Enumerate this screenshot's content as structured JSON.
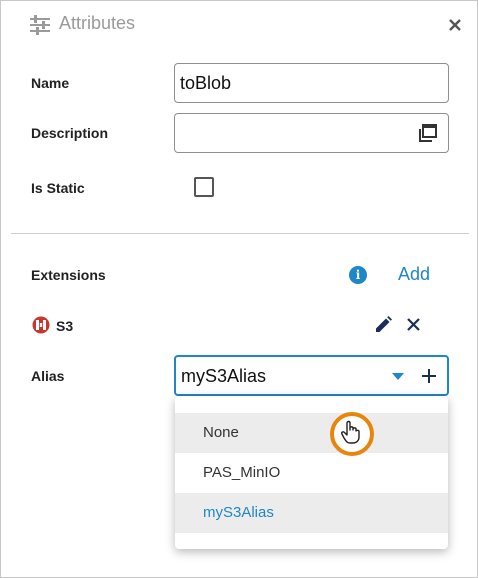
{
  "header": {
    "title": "Attributes",
    "icon": "sliders-icon",
    "close_icon": "close-icon"
  },
  "fields": {
    "name_label": "Name",
    "name_value": "toBlob",
    "description_label": "Description",
    "description_value": "",
    "is_static_label": "Is Static",
    "is_static_checked": false
  },
  "extensions": {
    "label": "Extensions",
    "info_icon": "info-icon",
    "add_label": "Add",
    "item": {
      "name": "S3",
      "icon": "s3-logo-icon",
      "edit_icon": "pencil-icon",
      "remove_icon": "close-icon"
    }
  },
  "alias": {
    "label": "Alias",
    "value": "myS3Alias",
    "options": [
      "None",
      "PAS_MinIO",
      "myS3Alias"
    ],
    "hovered_option": "None",
    "selected_option": "myS3Alias"
  },
  "colors": {
    "accent": "#1f86c7",
    "cursor_highlight": "#e8860b",
    "s3_icon": "#c9372c"
  }
}
